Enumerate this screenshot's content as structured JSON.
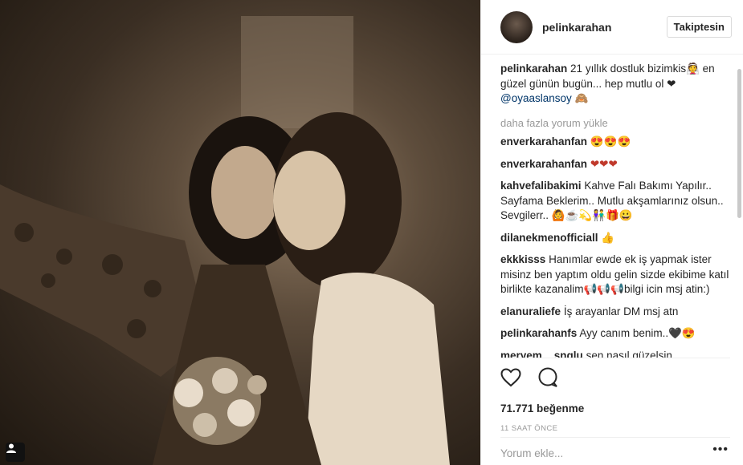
{
  "post": {
    "username": "pelinkarahan",
    "follow_label": "Takiptesin",
    "caption_user": "pelinkarahan",
    "caption_text": "21 yıllık dostluk bizimkis👰 en güzel günün bugün... hep mutlu ol ❤",
    "caption_mention": "@oyaaslansoy",
    "caption_emoji": "🙈",
    "load_more": "daha fazla yorum yükle",
    "likes": "71.771 beğenme",
    "time_ago": "11 SAAT ÖNCE",
    "add_comment_placeholder": "Yorum ekle...",
    "menu_dots": "•••",
    "icons": {
      "like": "heart-icon",
      "comment": "comment-icon",
      "user": "user-tag-icon"
    }
  },
  "comments": [
    {
      "user": "enverkarahanfan",
      "text": "😍😍😍"
    },
    {
      "user": "enverkarahanfan",
      "text": "❤❤❤"
    },
    {
      "user": "kahvefalibakimi",
      "text": "Kahve Falı Bakımı Yapılır.. Sayfama Beklerim.. Mutlu akşamlarınız olsun.. Sevgilerr.. 🙆☕💫👫🎁😀"
    },
    {
      "user": "dilanekmenofficiall",
      "text": "👍"
    },
    {
      "user": "ekkkisss",
      "text": "Hanımlar ewde ek iş yapmak ister misinz ben yaptım oldu gelin sizde ekibime katıl birlikte kazanalim📢📢📢bilgi icin msj atin:)"
    },
    {
      "user": "elanuraliefe",
      "text": "İş arayanlar DM msj atn"
    },
    {
      "user": "pelinkarahanfs",
      "text": "Ayy canım benim..🖤😍"
    },
    {
      "user": "meryem__snglu",
      "text": "sen nasıl güzelsin"
    }
  ]
}
